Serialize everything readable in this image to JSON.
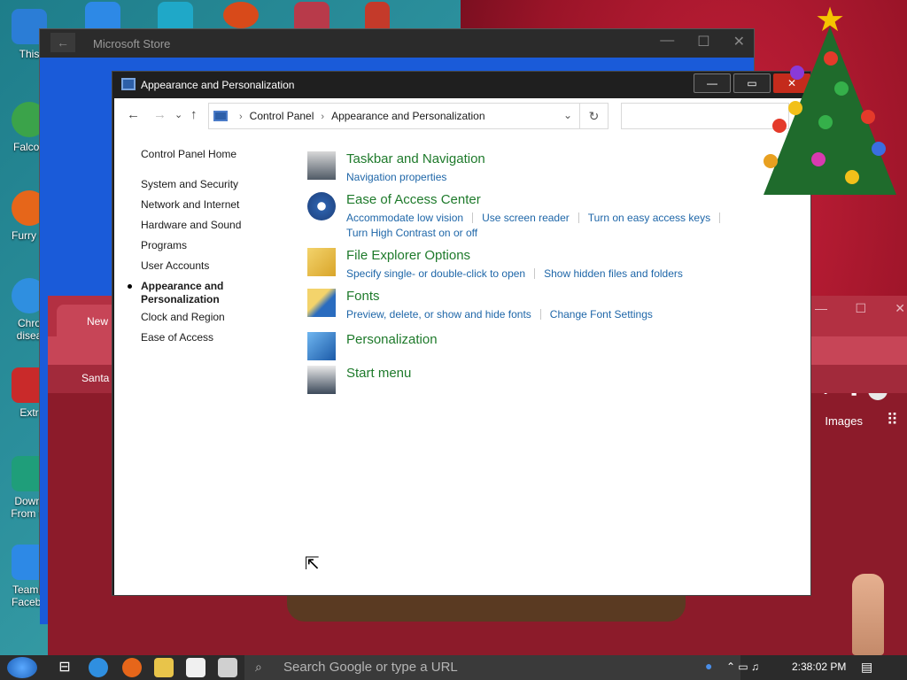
{
  "desktop": {
    "icons": [
      {
        "label": "This",
        "color": "#2b7dd6"
      },
      {
        "label": "Falcon",
        "color": "#3ba34a"
      },
      {
        "label": "Furry C",
        "color": "#e6661a"
      },
      {
        "label": "Chro disea",
        "color": "#2f8fe0"
      },
      {
        "label": "Extr",
        "color": "#c92a2a"
      },
      {
        "label": "Downl From te",
        "color": "#1f9e7a"
      },
      {
        "label": "TeamC Facebo",
        "color": "#2d89e6"
      }
    ]
  },
  "store_window": {
    "title": "Microsoft Store",
    "back": "←",
    "minimize": "—",
    "maximize": "☐",
    "close": "✕"
  },
  "chrome_window": {
    "tab_label": "New",
    "bookmark": "Santa",
    "images_link": "Images",
    "apps_icon": "⋮⋮⋮"
  },
  "control_panel": {
    "title": "Appearance and Personalization",
    "minimize": "—",
    "maximize": "▭",
    "close": "✕",
    "nav": {
      "back": "←",
      "forward": "→",
      "recent": "⌄",
      "up": "↑",
      "refresh": "↻",
      "dropdown": "⌄"
    },
    "breadcrumb": [
      "Control Panel",
      "Appearance and Personalization"
    ],
    "search_placeholder": "",
    "sidebar": {
      "home": "Control Panel Home",
      "items": [
        "System and Security",
        "Network and Internet",
        "Hardware and Sound",
        "Programs",
        "User Accounts",
        "Appearance and Personalization",
        "Clock and Region",
        "Ease of Access"
      ]
    },
    "categories": [
      {
        "title": "Taskbar and Navigation",
        "icon": "taskbar-icon",
        "links": [
          "Navigation properties"
        ]
      },
      {
        "title": "Ease of Access Center",
        "icon": "ease-of-access-icon",
        "links": [
          "Accommodate low vision",
          "Use screen reader",
          "Turn on easy access keys",
          "Turn High Contrast on or off"
        ]
      },
      {
        "title": "File Explorer Options",
        "icon": "folder-options-icon",
        "links": [
          "Specify single- or double-click to open",
          "Show hidden files and folders"
        ]
      },
      {
        "title": "Fonts",
        "icon": "fonts-icon",
        "links": [
          "Preview, delete, or show and hide fonts",
          "Change Font Settings"
        ]
      },
      {
        "title": "Personalization",
        "icon": "personalization-icon",
        "links": []
      },
      {
        "title": "Start menu",
        "icon": "start-menu-icon",
        "links": []
      }
    ]
  },
  "taskbar": {
    "search_placeholder": "Search Google or type a URL",
    "time": "2:38:02 PM"
  }
}
